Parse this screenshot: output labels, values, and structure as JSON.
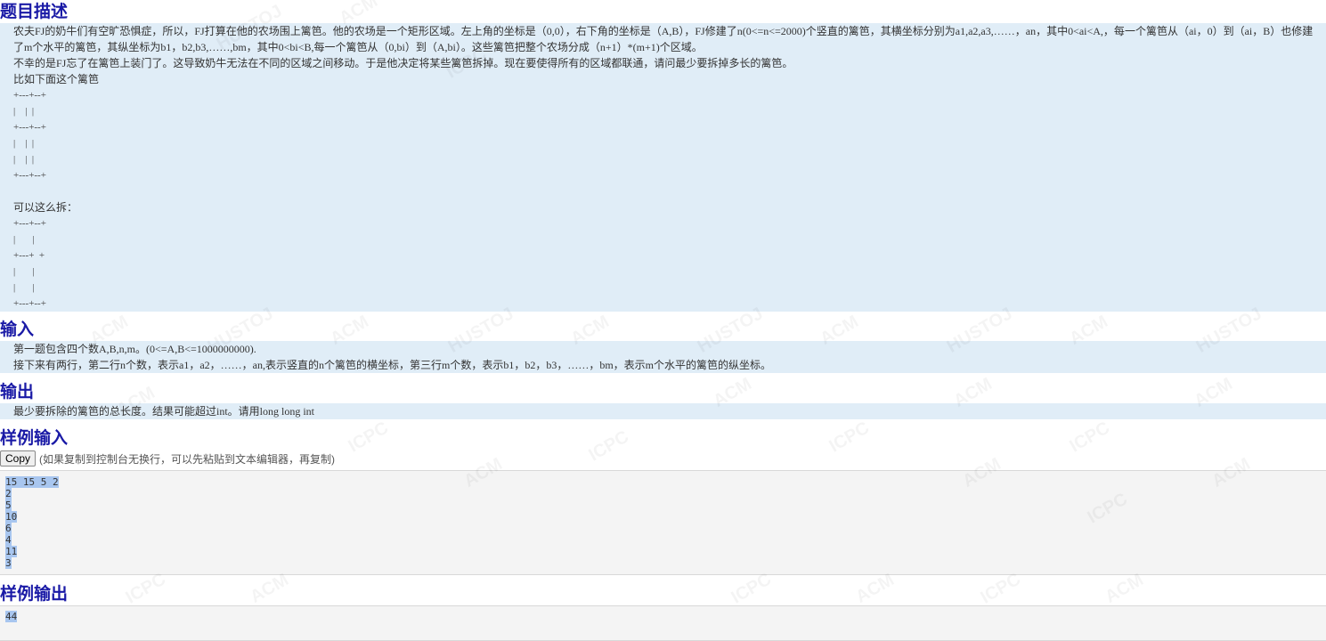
{
  "description": {
    "heading": "题目描述",
    "lines": [
      "农夫FJ的奶牛们有空旷恐惧症，所以，FJ打算在他的农场围上篱笆。他的农场是一个矩形区域。左上角的坐标是（0,0），右下角的坐标是（A,B），FJ修建了n(0<=n<=2000)个竖直的篱笆，其横坐标分别为a1,a2,a3,……，an，其中0<ai<A,，每一个篱笆从（ai，0）到（ai，B）也修建",
      "了m个水平的篱笆，其纵坐标为b1，b2,b3,……,bm，其中0<bi<B,每一个篱笆从（0,bi）到（A,bi）。这些篱笆把整个农场分成（n+1）*(m+1)个区域。",
      "不幸的是FJ忘了在篱笆上装门了。这导致奶牛无法在不同的区域之间移动。于是他决定将某些篱笆拆掉。现在要使得所有的区域都联通，请问最少要拆掉多长的篱笆。",
      "比如下面这个篱笆"
    ],
    "fence1": [
      "+---+--+",
      "|    |  |",
      "+---+--+",
      "|    |  |",
      "|    |  |",
      "+---+--+"
    ],
    "blank": " ",
    "can_remove": "可以这么拆：",
    "fence2": [
      "+---+--+",
      "|       |",
      "+---+  +",
      "|       |",
      "|       |",
      "+---+--+"
    ]
  },
  "input": {
    "heading": "输入",
    "lines": [
      "第一题包含四个数A,B,n,m。(0<=A,B<=1000000000).",
      "接下来有两行，第二行n个数，表示a1，a2，……，an,表示竖直的n个篱笆的横坐标，第三行m个数，表示b1，b2，b3，……，bm，表示m个水平的篱笆的纵坐标。"
    ]
  },
  "output": {
    "heading": "输出",
    "lines": [
      "最少要拆除的篱笆的总长度。结果可能超过int。请用long long int"
    ]
  },
  "sample_input": {
    "heading": "样例输入",
    "copy_label": "Copy",
    "hint": "(如果复制到控制台无换行，可以先粘贴到文本编辑器，再复制)",
    "lines": [
      "15 15 5 2",
      "2",
      "5",
      "10",
      "6",
      "4",
      "11",
      "3"
    ]
  },
  "sample_output": {
    "heading": "样例输出",
    "lines": [
      "44"
    ]
  },
  "watermark": [
    "HUSTOJ",
    "ACM",
    "ICPC"
  ]
}
